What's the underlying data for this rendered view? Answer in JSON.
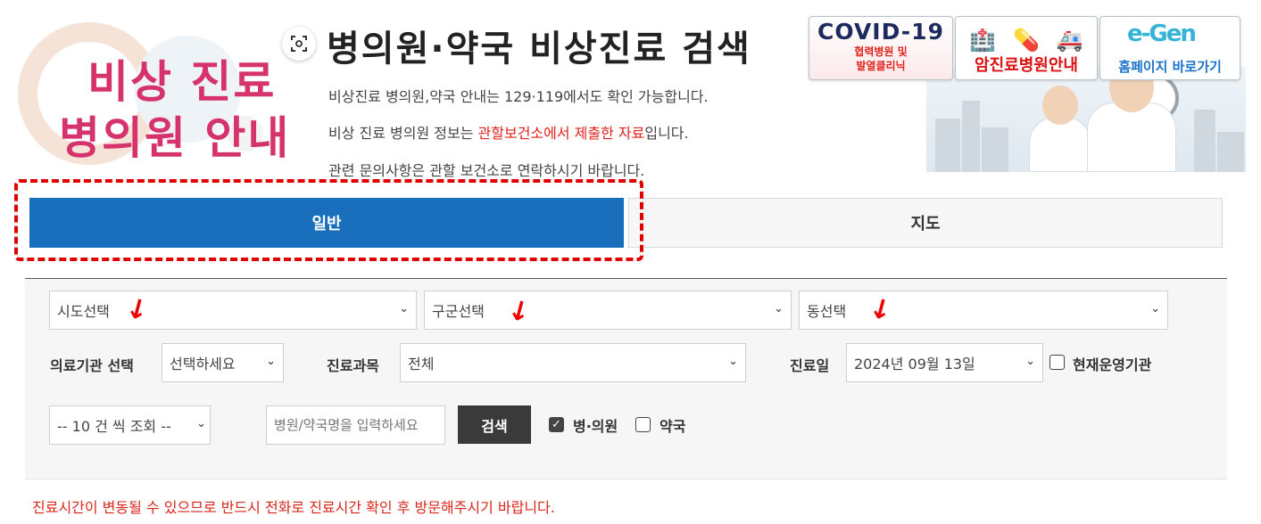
{
  "banner": {
    "line1": "비상 진료",
    "line2": "병의원 안내"
  },
  "header": {
    "title": "병의원·약국 비상진료 검색",
    "desc1": "비상진료 병의원,약국 안내는 129·119에서도 확인 가능합니다.",
    "desc2_pre": "비상 진료 병의원 정보는 ",
    "desc2_red": "관할보건소에서 제출한 자료",
    "desc2_post": "입니다.",
    "desc3": "관련 문의사항은 관할 보건소로 연락하시기 바랍니다."
  },
  "side_banners": {
    "covid_big": "COVID-19",
    "covid_line1": "협력병원 및",
    "covid_line2": "발열클리닉",
    "cancer": "암진료병원안내",
    "egen_logo": "e-Gen",
    "homepage": "홈페이지 바로가기"
  },
  "tabs": {
    "general": "일반",
    "map": "지도"
  },
  "search": {
    "sido": "시도선택",
    "gugun": "구군선택",
    "dong": "동선택",
    "institution_label": "의료기관 선택",
    "institution_value": "선택하세요",
    "department_label": "진료과목",
    "department_value": "전체",
    "date_label": "진료일",
    "date_value": "2024년 09월 13일",
    "operating_label": "현재운영기관",
    "page_size": "-- 10 건 씩 조회 --",
    "name_placeholder": "병원/약국명을 입력하세요",
    "search_button": "검색",
    "hospital_label": "병·의원",
    "pharmacy_label": "약국"
  },
  "notice": "진료시간이 변동될 수 있으므로 반드시 전화로 진료시간 확인 후 방문해주시기 바랍니다.",
  "colors": {
    "tab_active": "#1a6fbd",
    "highlight_red": "#e00000",
    "notice_red": "#d9251c",
    "search_button": "#3a3a3a"
  },
  "icons": {
    "qr": "qr-scan-icon",
    "chevron": "chevron-down-icon",
    "annotation_arrow": "red-arrow-icon",
    "checkmark": "check-icon"
  }
}
